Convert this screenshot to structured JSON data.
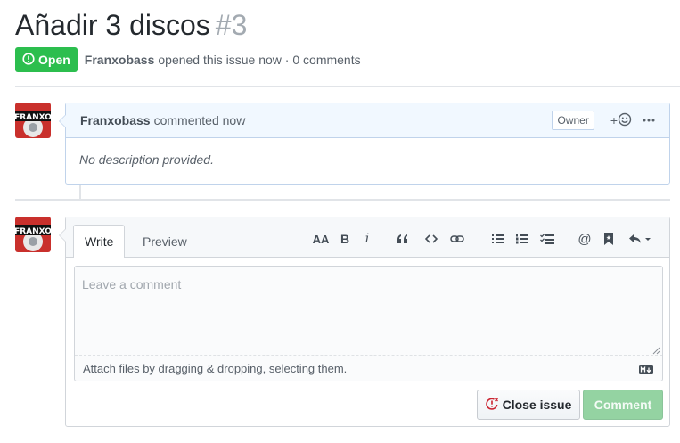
{
  "issue": {
    "title": "Añadir 3 discos",
    "number": "#3",
    "state": "Open",
    "author": "Franxobass",
    "opened_text": "opened this issue now · 0 comments"
  },
  "comment": {
    "author": "Franxobass",
    "time_text": "commented now",
    "badge": "Owner",
    "reaction_plus": "+",
    "body": "No description provided."
  },
  "new_comment": {
    "tabs": [
      {
        "label": "Write",
        "active": true
      },
      {
        "label": "Preview",
        "active": false
      }
    ],
    "toolbar": {
      "heading": "AA",
      "bold": "B",
      "italic": "i",
      "mention": "@"
    },
    "placeholder": "Leave a comment",
    "attach_text": "Attach files by dragging & dropping, selecting them.",
    "close_button": "Close issue",
    "comment_button": "Comment"
  },
  "avatar_text": "FRANXO",
  "icons": [
    "issue-opened-icon",
    "smiley-icon",
    "kebab-icon",
    "heading-icon",
    "bold-icon",
    "italic-icon",
    "quote-icon",
    "code-icon",
    "link-icon",
    "unordered-list-icon",
    "ordered-list-icon",
    "tasklist-icon",
    "mention-icon",
    "bookmark-icon",
    "reply-icon",
    "markdown-icon"
  ],
  "colors": {
    "open_green": "#2cbe4e",
    "comment_header_bg": "#f1f8ff",
    "comment_border": "#c0d3eb",
    "disabled_green": "#94d3a2",
    "close_icon_red": "#cb2431"
  }
}
